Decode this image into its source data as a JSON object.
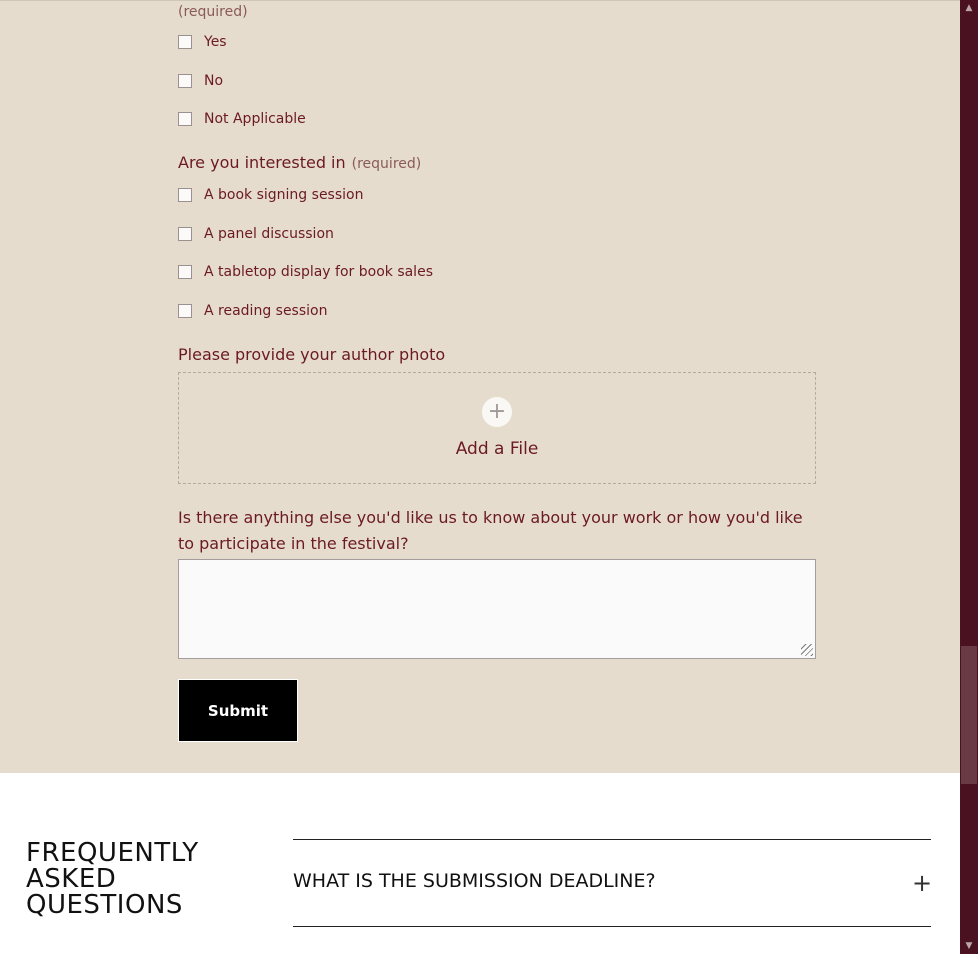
{
  "form": {
    "required_note_top": "(required)",
    "question1_options": [
      "Yes",
      "No",
      "Not Applicable"
    ],
    "question2": {
      "label": "Are you interested in",
      "required": "(required)",
      "options": [
        "A book signing session",
        "A panel discussion",
        "A tabletop display for book sales",
        "A reading session"
      ]
    },
    "photo": {
      "label": "Please provide your author photo",
      "add_file": "Add a File",
      "icon": "plus-icon"
    },
    "other": {
      "label": "Is there anything else you'd like us to know about your work or how you'd like to participate in the festival?",
      "value": ""
    },
    "submit_label": "Submit"
  },
  "faq": {
    "title_lines": [
      "FREQUENTLY",
      "ASKED",
      "QUESTIONS"
    ],
    "items": [
      {
        "question": "WHAT IS THE SUBMISSION DEADLINE?",
        "icon": "plus-icon"
      }
    ]
  },
  "colors": {
    "form_bg": "#e6dccd",
    "accent_text": "#6b1a22",
    "submit_bg": "#000000",
    "scrollbar": "#4a1220"
  }
}
